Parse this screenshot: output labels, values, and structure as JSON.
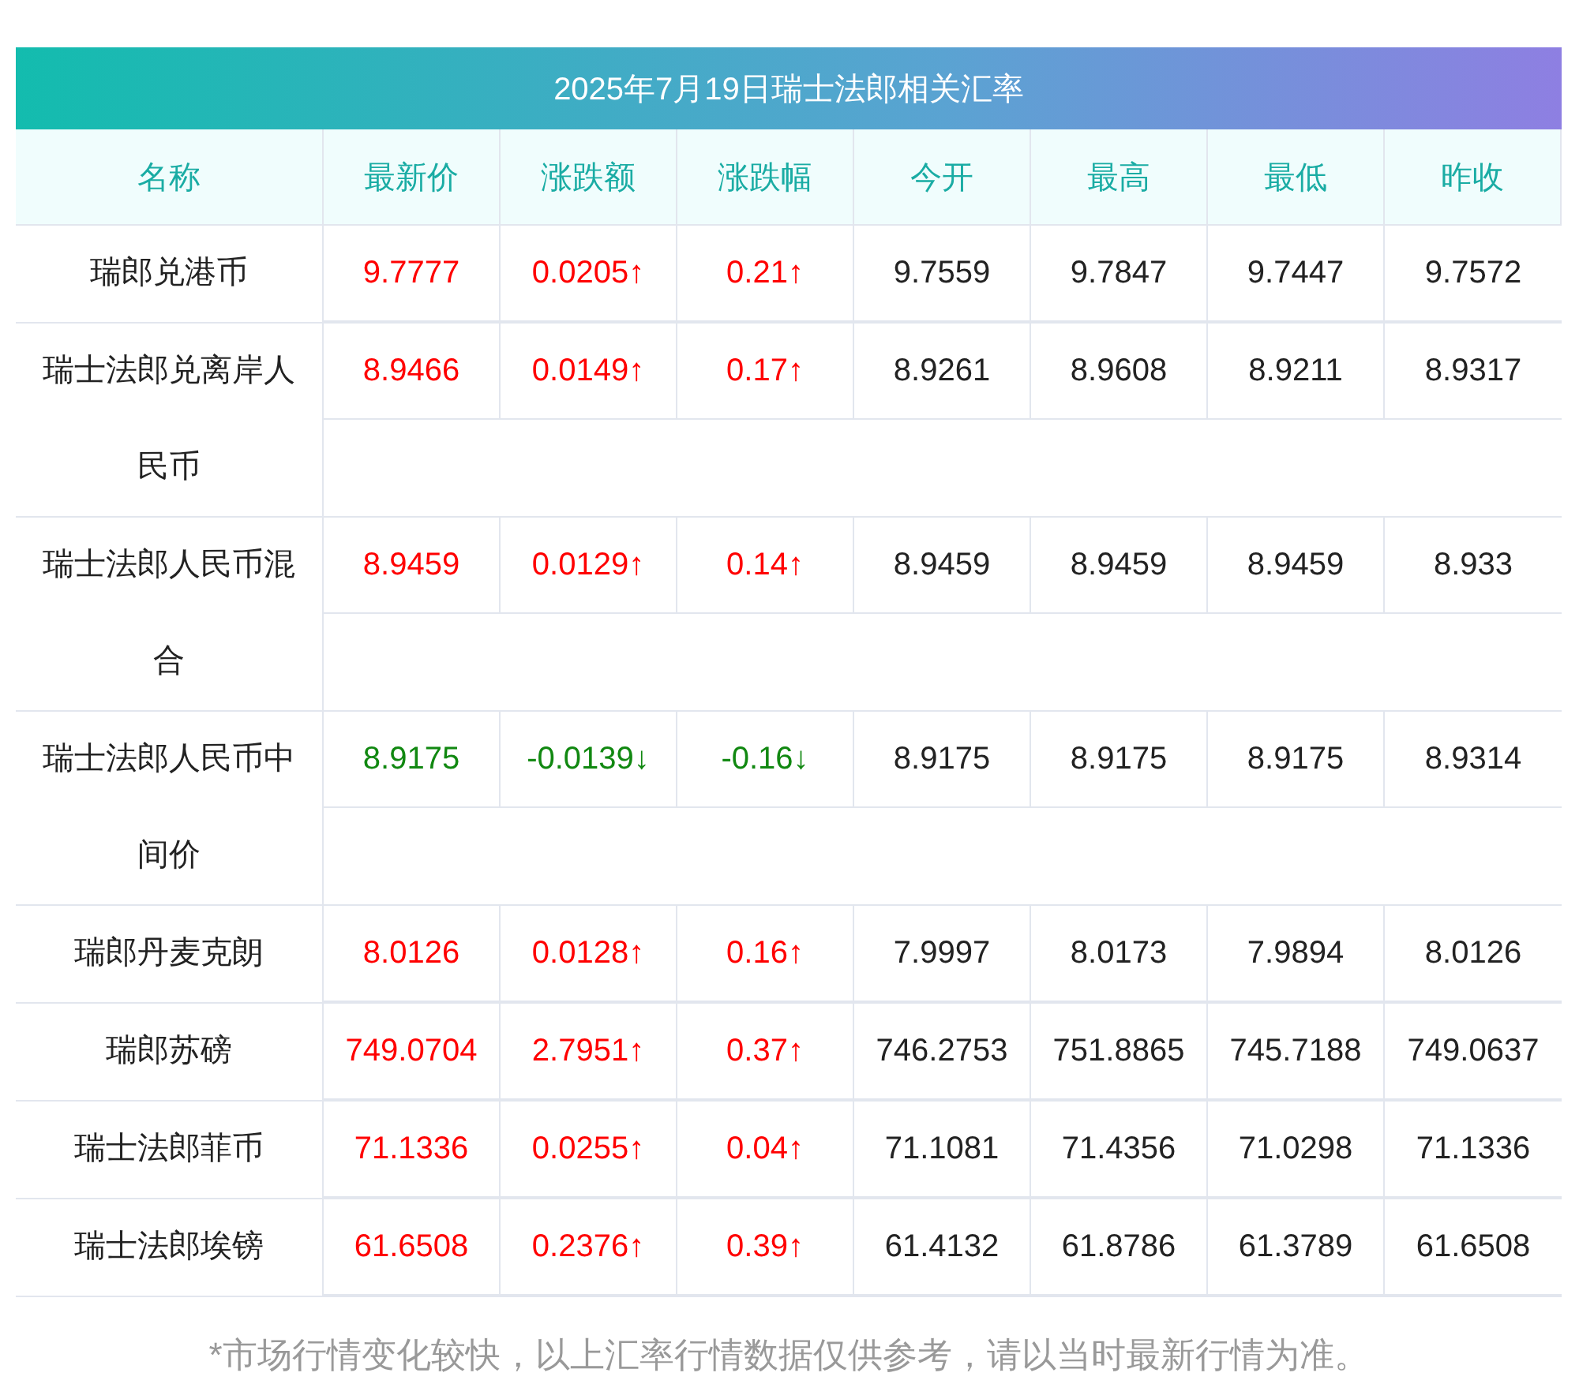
{
  "title": "2025年7月19日瑞士法郎相关汇率",
  "columns": [
    "名称",
    "最新价",
    "涨跌额",
    "涨跌幅",
    "今开",
    "最高",
    "最低",
    "昨收"
  ],
  "rows": [
    {
      "name": "瑞郎兑港币",
      "color": "#ff0000",
      "cells": [
        "9.7777",
        "0.0205↑",
        "0.21↑",
        "9.7559",
        "9.7847",
        "9.7447",
        "9.7572"
      ]
    },
    {
      "name": "瑞士法郎兑离岸人民币",
      "color": "#ff0000",
      "cells": [
        "8.9466",
        "0.0149↑",
        "0.17↑",
        "8.9261",
        "8.9608",
        "8.9211",
        "8.9317"
      ]
    },
    {
      "name": "瑞士法郎人民币混合",
      "color": "#ff0000",
      "cells": [
        "8.9459",
        "0.0129↑",
        "0.14↑",
        "8.9459",
        "8.9459",
        "8.9459",
        "8.933"
      ]
    },
    {
      "name": "瑞士法郎人民币中间价",
      "color": "#118811",
      "cells": [
        "8.9175",
        "-0.0139↓",
        "-0.16↓",
        "8.9175",
        "8.9175",
        "8.9175",
        "8.9314"
      ]
    },
    {
      "name": "瑞郎丹麦克朗",
      "color": "#ff0000",
      "cells": [
        "8.0126",
        "0.0128↑",
        "0.16↑",
        "7.9997",
        "8.0173",
        "7.9894",
        "8.0126"
      ]
    },
    {
      "name": "瑞郎苏磅",
      "color": "#ff0000",
      "cells": [
        "749.0704",
        "2.7951↑",
        "0.37↑",
        "746.2753",
        "751.8865",
        "745.7188",
        "749.0637"
      ]
    },
    {
      "name": "瑞士法郎菲币",
      "color": "#ff0000",
      "cells": [
        "71.1336",
        "0.0255↑",
        "0.04↑",
        "71.1081",
        "71.4356",
        "71.0298",
        "71.1336"
      ]
    },
    {
      "name": "瑞士法郎埃镑",
      "color": "#ff0000",
      "cells": [
        "61.6508",
        "0.2376↑",
        "0.39↑",
        "61.4132",
        "61.8786",
        "61.3789",
        "61.6508"
      ]
    }
  ],
  "note": "*市场行情变化较快，以上汇率行情数据仅供参考，请以当时最新行情为准。"
}
